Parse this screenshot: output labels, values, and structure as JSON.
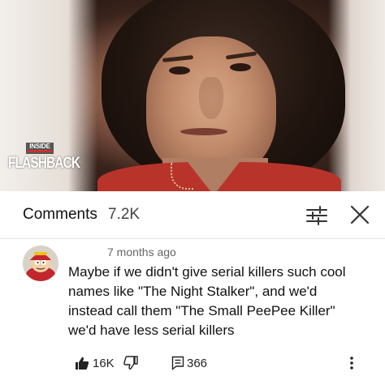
{
  "video": {
    "logo_top": "INSIDE",
    "logo_main": "FLASHBACK"
  },
  "comments_header": {
    "title": "Comments",
    "count": "7.2K",
    "filter_icon": "sliders-icon",
    "close_icon": "close-icon"
  },
  "comment": {
    "timestamp": "7 months ago",
    "lines": [
      "Maybe if we didn't give serial killers such cool",
      "names like \"The Night Stalker\", and we'd",
      "instead call them \"The Small PeePee Killer\"",
      "we'd have less serial killers"
    ],
    "likes": "16K",
    "replies": "366",
    "icons": [
      "thumb-up-icon",
      "thumb-down-icon",
      "reply-icon",
      "more-vert-icon"
    ]
  },
  "colors": {
    "text_primary": "#111111",
    "text_secondary": "#666666",
    "shirt_red": "#b8342b"
  }
}
